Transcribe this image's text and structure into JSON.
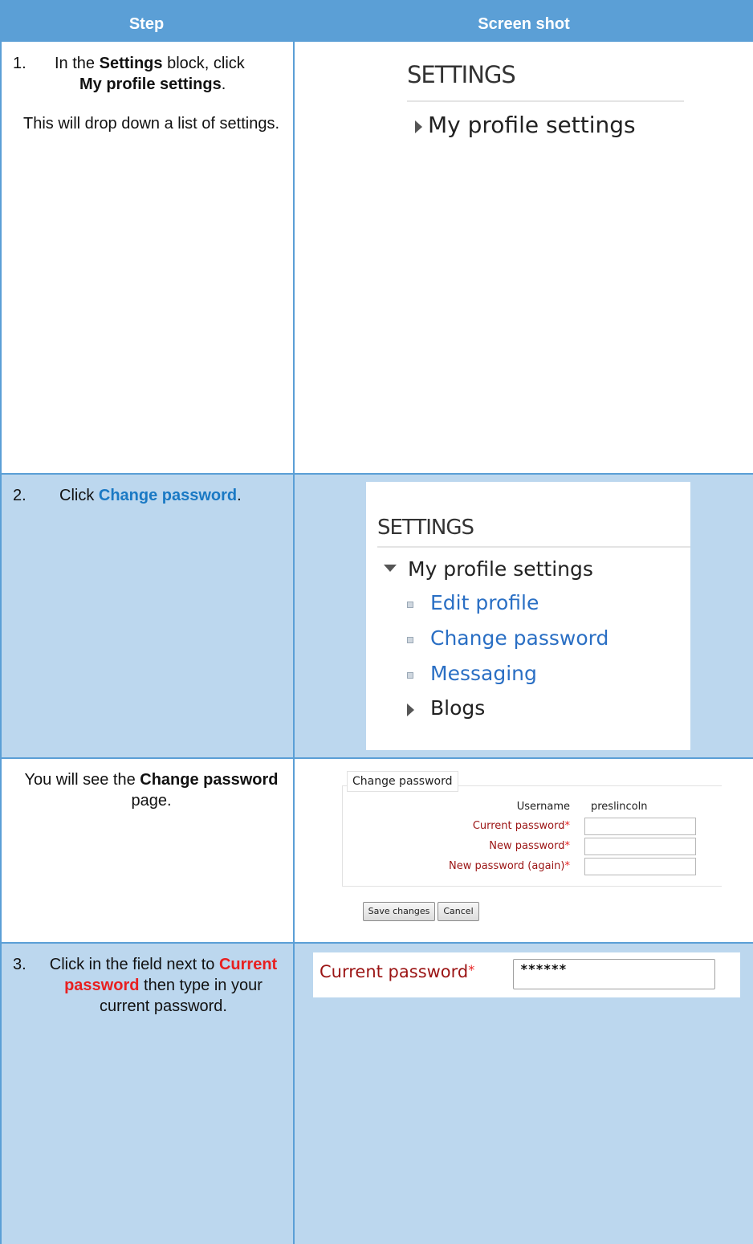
{
  "header": {
    "step": "Step",
    "screenshot": "Screen shot"
  },
  "row1": {
    "num": "1.",
    "line1_pre": "In the ",
    "line1_bold": "Settings",
    "line1_post": " block, click",
    "line2_bold": "My profile settings",
    "line2_post": ".",
    "para2": "This will drop down a list of settings.",
    "shot": {
      "title": "SETTINGS",
      "item": "My profile settings"
    }
  },
  "row2": {
    "num": "2.",
    "pre": "Click ",
    "link": "Change password",
    "post": ".",
    "shot": {
      "title": "SETTINGS",
      "parent": "My profile settings",
      "items": [
        "Edit profile",
        "Change password",
        "Messaging"
      ],
      "blogs": "Blogs"
    }
  },
  "row2b": {
    "pre": "You will see the ",
    "bold": "Change password",
    "post": " page.",
    "shot": {
      "legend": "Change password",
      "username_label": "Username",
      "username_value": "preslincoln",
      "current_label": "Current password",
      "new_label": "New password",
      "again_label": "New password (again)",
      "required": "*",
      "save": "Save changes",
      "cancel": "Cancel"
    }
  },
  "row3": {
    "num": "3.",
    "pre": "Click in the field next to ",
    "red": "Current password",
    "post": " then type in your current password.",
    "shot": {
      "label": "Current password",
      "required": "*",
      "value": "******"
    }
  },
  "colors": {
    "header": "#5b9fd6",
    "row_alt": "#bcd7ee",
    "link": "#1a79c4",
    "required": "#e82020"
  }
}
